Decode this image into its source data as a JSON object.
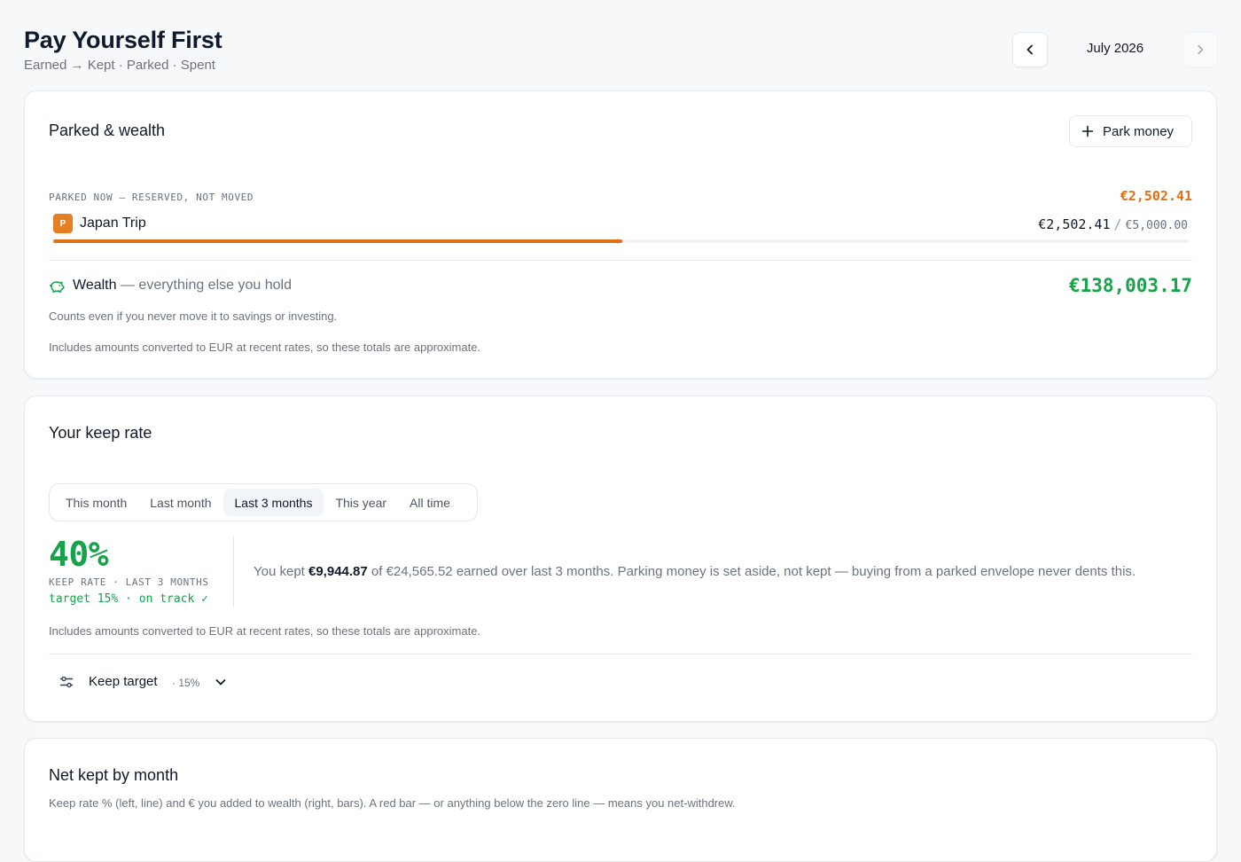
{
  "header": {
    "title": "Pay Yourself First",
    "subtitle": "Earned → Kept · Parked · Spent",
    "month": "July 2026"
  },
  "parked_card": {
    "title": "Parked & wealth",
    "park_button_label": "Park money",
    "parked_label": "PARKED NOW — RESERVED, NOT MOVED",
    "parked_total": "€2,502.41",
    "envelopes": [
      {
        "badge": "P",
        "name": "Japan Trip",
        "amount": "€2,502.41",
        "goal": "€5,000.00",
        "progress": 0.5005,
        "color": "#e07016"
      }
    ],
    "wealth_label": "Wealth",
    "wealth_suffix": "— everything else you hold",
    "wealth_total": "€138,003.17",
    "wealth_note": "Counts even if you never move it to savings or investing.",
    "approx_note": "Includes amounts converted to EUR at recent rates, so these totals are approximate."
  },
  "keep_card": {
    "title": "Your keep rate",
    "tabs": [
      "This month",
      "Last month",
      "Last 3 months",
      "This year",
      "All time"
    ],
    "active_tab": "Last 3 months",
    "keep_rate": "40%",
    "keep_rate_label": "KEEP RATE · LAST 3 MONTHS",
    "status": "target 15% · on track ✓",
    "sentence_pre": "You kept ",
    "kept_amount": "€9,944.87",
    "sentence_post": " of €24,565.52 earned over last 3 months. Parking money is set aside, not kept — buying from a parked envelope never dents this.",
    "approx_note": "Includes amounts converted to EUR at recent rates, so these totals are approximate.",
    "target_label": "Keep target",
    "target_value": "· 15%"
  },
  "net_card": {
    "title": "Net kept by month",
    "description": "Keep rate % (left, line) and € you added to wealth (right, bars). A red bar — or anything below the zero line — means you net-withdrew."
  },
  "colors": {
    "accent_green": "#16a34a",
    "accent_orange": "#e07016"
  },
  "icons": [
    "chevron-left-icon",
    "chevron-right-icon",
    "plus-icon",
    "piggy-bank-icon",
    "sliders-icon",
    "chevron-down-icon"
  ]
}
